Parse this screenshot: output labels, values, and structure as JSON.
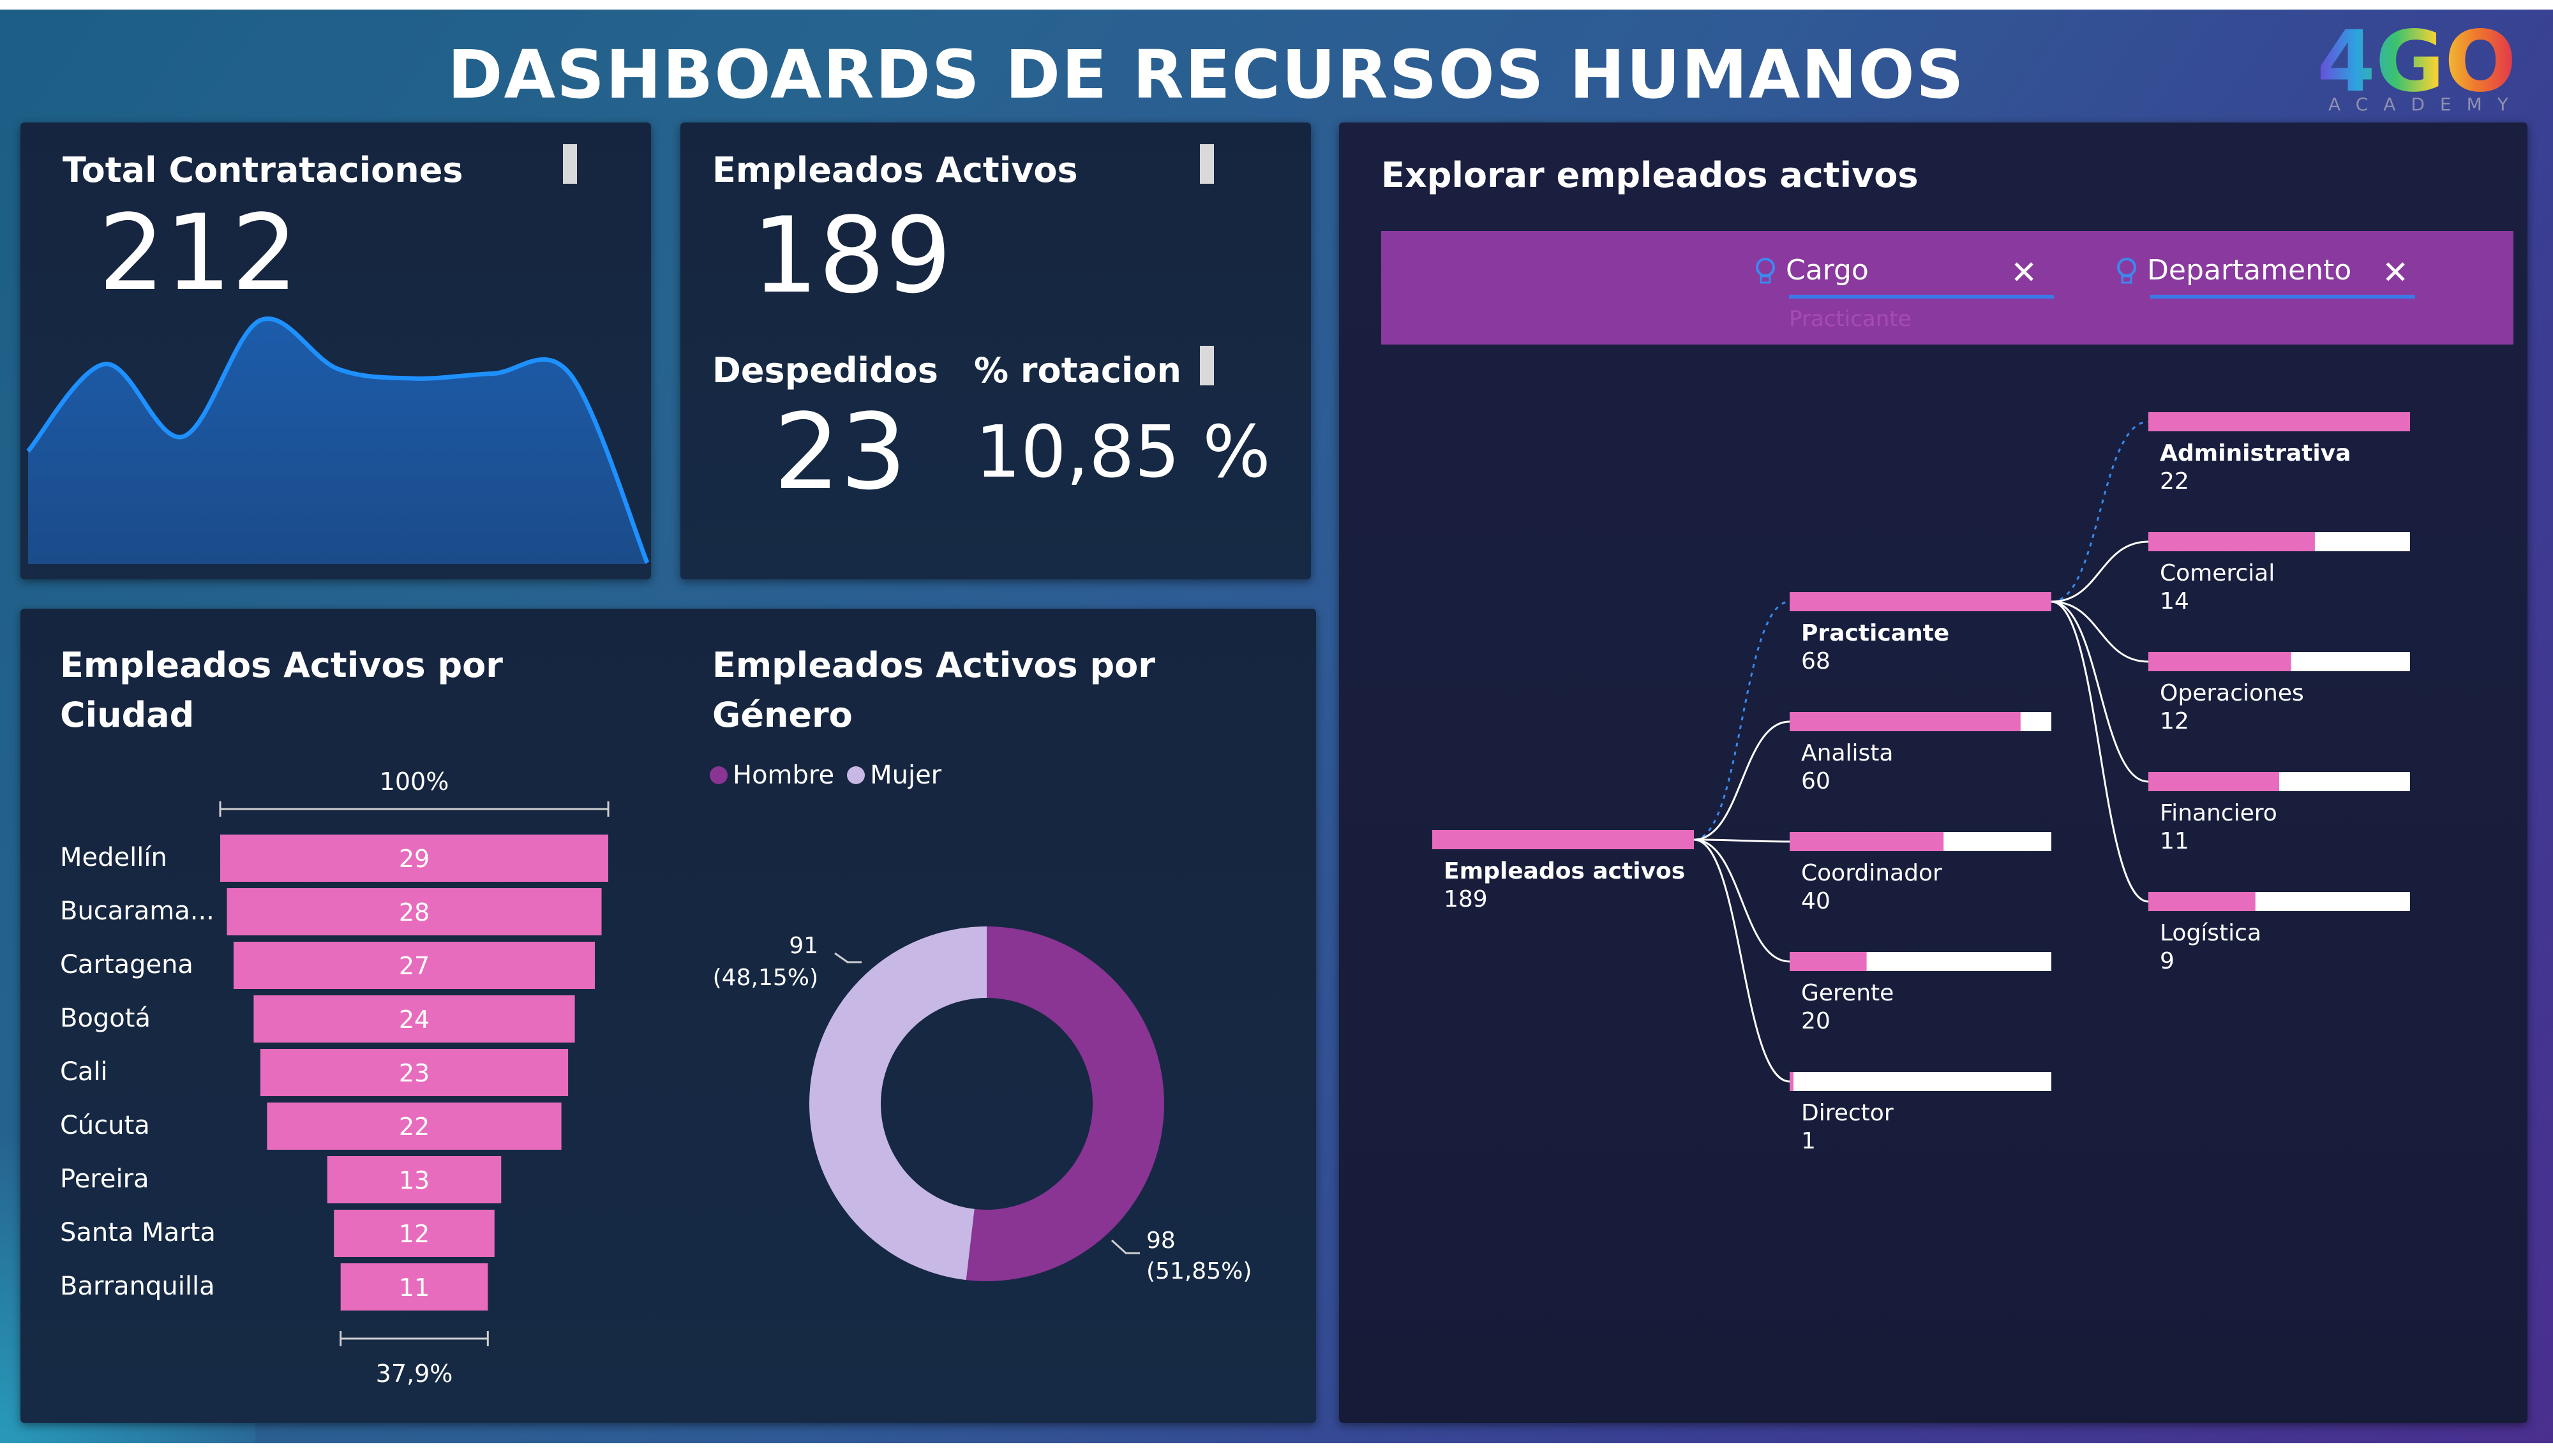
{
  "header": {
    "title": "DASHBOARDS DE RECURSOS HUMANOS",
    "logo_text": "4GO",
    "logo_sub": "ACADEMY"
  },
  "kpis": {
    "total_contrataciones": {
      "label": "Total Contrataciones",
      "value": "212"
    },
    "empleados_activos": {
      "label": "Empleados Activos",
      "value": "189"
    },
    "despedidos": {
      "label": "Despedidos",
      "value": "23"
    },
    "rotacion": {
      "label": "% rotacion",
      "value": "10,85 %"
    }
  },
  "ciudad": {
    "title": "Empleados Activos por Ciudad",
    "top_pct": "100%",
    "bottom_pct": "37,9%"
  },
  "genero": {
    "title": "Empleados Activos por Género",
    "legend": [
      "Hombre",
      "Mujer"
    ]
  },
  "explorar": {
    "title": "Explorar empleados activos",
    "filters": [
      {
        "label": "Cargo",
        "value": "Practicante"
      },
      {
        "label": "Departamento"
      }
    ],
    "root": {
      "label": "Empleados activos",
      "value": 189
    },
    "cargos": [
      {
        "label": "Practicante",
        "value": 68
      },
      {
        "label": "Analista",
        "value": 60
      },
      {
        "label": "Coordinador",
        "value": 40
      },
      {
        "label": "Gerente",
        "value": 20
      },
      {
        "label": "Director",
        "value": 1
      }
    ],
    "departamentos": [
      {
        "label": "Administrativa",
        "value": 22
      },
      {
        "label": "Comercial",
        "value": 14
      },
      {
        "label": "Operaciones",
        "value": 12
      },
      {
        "label": "Financiero",
        "value": 11
      },
      {
        "label": "Logística",
        "value": 9
      }
    ]
  },
  "colors": {
    "pink": "#e86cbd",
    "hombre": "#8a3494",
    "mujer": "#c8b8e6",
    "line": "#1e90ff",
    "filter_bar": "#8a3a9e",
    "underline": "#3a7ae8"
  },
  "chart_data": [
    {
      "type": "area",
      "title": "Total Contrataciones",
      "series": [
        {
          "values": [
            46,
            82,
            52,
            100,
            80,
            76,
            78,
            78,
            0
          ]
        }
      ],
      "grid": false
    },
    {
      "type": "bar",
      "title": "Empleados Activos por Ciudad",
      "subtype": "funnel",
      "categories": [
        "Medellín",
        "Bucarama...",
        "Cartagena",
        "Bogotá",
        "Cali",
        "Cúcuta",
        "Pereira",
        "Santa Marta",
        "Barranquilla"
      ],
      "values": [
        29,
        28,
        27,
        24,
        23,
        22,
        13,
        12,
        11
      ],
      "annotations": [
        "100%",
        "37,9%"
      ]
    },
    {
      "type": "pie",
      "subtype": "donut",
      "title": "Empleados Activos por Género",
      "categories": [
        "Hombre",
        "Mujer"
      ],
      "values": [
        98,
        91
      ],
      "labels": [
        "(51,85%)",
        "(48,15%)"
      ],
      "legend": "top-left"
    },
    {
      "type": "bar",
      "subtype": "decomposition-tree",
      "title": "Explorar empleados activos",
      "levels": [
        {
          "categories": [
            "Empleados activos"
          ],
          "values": [
            189
          ]
        },
        {
          "name": "Cargo",
          "categories": [
            "Practicante",
            "Analista",
            "Coordinador",
            "Gerente",
            "Director"
          ],
          "values": [
            68,
            60,
            40,
            20,
            1
          ]
        },
        {
          "name": "Departamento",
          "categories": [
            "Administrativa",
            "Comercial",
            "Operaciones",
            "Financiero",
            "Logística"
          ],
          "values": [
            22,
            14,
            12,
            11,
            9
          ]
        }
      ]
    }
  ]
}
